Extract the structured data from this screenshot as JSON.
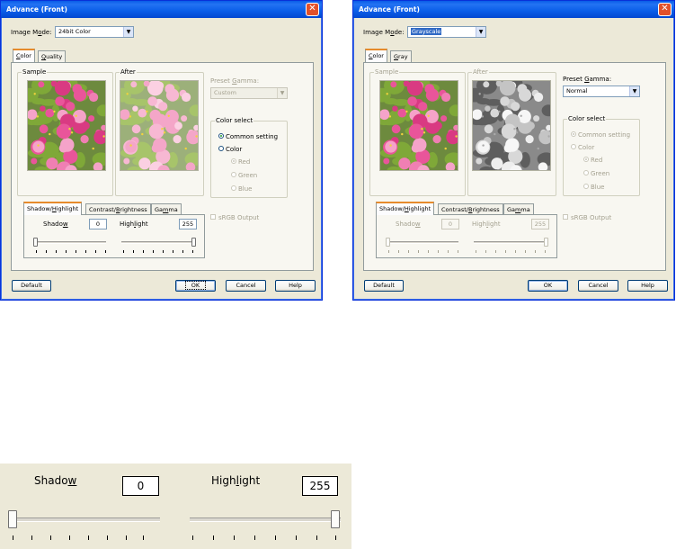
{
  "dialogs": [
    {
      "title": "Advance (Front)",
      "image_mode_label": "Image Mode:",
      "image_mode_value": "24bit Color",
      "tabs": [
        "Color",
        "Quality"
      ],
      "sample_label": "Sample",
      "after_label": "After",
      "preset_gamma_label": "Preset Gamma:",
      "preset_gamma_value": "Custom",
      "color_select_label": "Color select",
      "radio_common": "Common setting",
      "radio_color": "Color",
      "radio_red": "Red",
      "radio_green": "Green",
      "radio_blue": "Blue",
      "srgb_label": "sRGB Output",
      "subtabs": [
        "Shadow/Highlight",
        "Contrast/Brightness",
        "Gamma"
      ],
      "shadow_label": "Shadow",
      "shadow_value": "0",
      "highlight_label": "Highlight",
      "highlight_value": "255",
      "btn_default": "Default",
      "btn_ok": "OK",
      "btn_cancel": "Cancel",
      "btn_help": "Help"
    },
    {
      "title": "Advance (Front)",
      "image_mode_label": "Image Mode:",
      "image_mode_value": "Grayscale",
      "tabs": [
        "Color",
        "Gray"
      ],
      "sample_label": "Sample",
      "after_label": "After",
      "preset_gamma_label": "Preset Gamma:",
      "preset_gamma_value": "Normal",
      "color_select_label": "Color select",
      "radio_common": "Common setting",
      "radio_color": "Color",
      "radio_red": "Red",
      "radio_green": "Green",
      "radio_blue": "Blue",
      "srgb_label": "sRGB Output",
      "subtabs": [
        "Shadow/Highlight",
        "Contrast/Brightness",
        "Gamma"
      ],
      "shadow_label": "Shadow",
      "shadow_value": "0",
      "highlight_label": "Highlight",
      "highlight_value": "255",
      "btn_default": "Default",
      "btn_ok": "OK",
      "btn_cancel": "Cancel",
      "btn_help": "Help"
    }
  ],
  "zoom": {
    "shadow_label": "Shadow",
    "shadow_value": "0",
    "highlight_label": "Highlight",
    "highlight_value": "255"
  },
  "icons": {
    "close": "close-icon",
    "dropdown": "chevron-down-icon"
  },
  "colors": {
    "title_bar": "#0a5ce8",
    "close_button": "#e2512a",
    "dialog_bg": "#ece9d8",
    "tab_highlight": "#e68b2c"
  }
}
